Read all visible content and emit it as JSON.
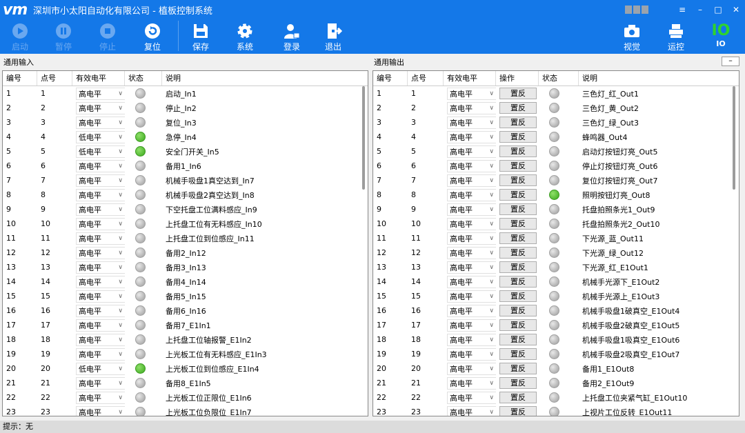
{
  "titlebar": {
    "logo": "vm",
    "title": "深圳市小太阳自动化有限公司 - 植板控制系统",
    "menu": "≡",
    "minimize": "–",
    "maximize": "□",
    "close": "✕"
  },
  "toolbar": {
    "start": "启动",
    "pause": "暂停",
    "stop": "停止",
    "reset": "复位",
    "save": "保存",
    "system": "系统",
    "login": "登录",
    "exit": "退出",
    "vision": "视觉",
    "motion": "运控",
    "io_big": "IO",
    "io_small": "IO"
  },
  "input_panel": {
    "title": "通用输入",
    "headers": [
      "编号",
      "点号",
      "有效电平",
      "状态",
      "说明"
    ],
    "rows": [
      {
        "no": "1",
        "pt": "1",
        "level": "高电平",
        "on": false,
        "desc": "启动_In1"
      },
      {
        "no": "2",
        "pt": "2",
        "level": "高电平",
        "on": false,
        "desc": "停止_In2"
      },
      {
        "no": "3",
        "pt": "3",
        "level": "高电平",
        "on": false,
        "desc": "复位_In3"
      },
      {
        "no": "4",
        "pt": "4",
        "level": "低电平",
        "on": true,
        "desc": "急停_In4"
      },
      {
        "no": "5",
        "pt": "5",
        "level": "低电平",
        "on": true,
        "desc": "安全门开关_In5"
      },
      {
        "no": "6",
        "pt": "6",
        "level": "高电平",
        "on": false,
        "desc": "备用1_In6"
      },
      {
        "no": "7",
        "pt": "7",
        "level": "高电平",
        "on": false,
        "desc": "机械手吸盘1真空达到_In7"
      },
      {
        "no": "8",
        "pt": "8",
        "level": "高电平",
        "on": false,
        "desc": "机械手吸盘2真空达到_In8"
      },
      {
        "no": "9",
        "pt": "9",
        "level": "高电平",
        "on": false,
        "desc": "下空托盘工位满料感应_In9"
      },
      {
        "no": "10",
        "pt": "10",
        "level": "高电平",
        "on": false,
        "desc": "上托盘工位有无料感应_In10"
      },
      {
        "no": "11",
        "pt": "11",
        "level": "高电平",
        "on": false,
        "desc": "上托盘工位到位感应_In11"
      },
      {
        "no": "12",
        "pt": "12",
        "level": "高电平",
        "on": false,
        "desc": "备用2_In12"
      },
      {
        "no": "13",
        "pt": "13",
        "level": "高电平",
        "on": false,
        "desc": "备用3_In13"
      },
      {
        "no": "14",
        "pt": "14",
        "level": "高电平",
        "on": false,
        "desc": "备用4_In14"
      },
      {
        "no": "15",
        "pt": "15",
        "level": "高电平",
        "on": false,
        "desc": "备用5_In15"
      },
      {
        "no": "16",
        "pt": "16",
        "level": "高电平",
        "on": false,
        "desc": "备用6_In16"
      },
      {
        "no": "17",
        "pt": "17",
        "level": "高电平",
        "on": false,
        "desc": "备用7_E1In1"
      },
      {
        "no": "18",
        "pt": "18",
        "level": "高电平",
        "on": false,
        "desc": "上托盘工位轴报警_E1In2"
      },
      {
        "no": "19",
        "pt": "19",
        "level": "高电平",
        "on": false,
        "desc": "上光板工位有无料感应_E1In3"
      },
      {
        "no": "20",
        "pt": "20",
        "level": "低电平",
        "on": true,
        "desc": "上光板工位到位感应_E1In4"
      },
      {
        "no": "21",
        "pt": "21",
        "level": "高电平",
        "on": false,
        "desc": "备用8_E1In5"
      },
      {
        "no": "22",
        "pt": "22",
        "level": "高电平",
        "on": false,
        "desc": "上光板工位正限位_E1In6"
      },
      {
        "no": "23",
        "pt": "23",
        "level": "高电平",
        "on": false,
        "desc": "上光板工位负限位_E1In7"
      }
    ]
  },
  "output_panel": {
    "title": "通用输出",
    "collapse": "–",
    "headers": [
      "编号",
      "点号",
      "有效电平",
      "操作",
      "状态",
      "说明"
    ],
    "flip_label": "置反",
    "rows": [
      {
        "no": "1",
        "pt": "1",
        "level": "高电平",
        "on": false,
        "desc": "三色灯_红_Out1"
      },
      {
        "no": "2",
        "pt": "2",
        "level": "高电平",
        "on": false,
        "desc": "三色灯_黄_Out2"
      },
      {
        "no": "3",
        "pt": "3",
        "level": "高电平",
        "on": false,
        "desc": "三色灯_绿_Out3"
      },
      {
        "no": "4",
        "pt": "4",
        "level": "高电平",
        "on": false,
        "desc": "蜂鸣器_Out4"
      },
      {
        "no": "5",
        "pt": "5",
        "level": "高电平",
        "on": false,
        "desc": "启动灯按钮灯亮_Out5"
      },
      {
        "no": "6",
        "pt": "6",
        "level": "高电平",
        "on": false,
        "desc": "停止灯按钮灯亮_Out6"
      },
      {
        "no": "7",
        "pt": "7",
        "level": "高电平",
        "on": false,
        "desc": "复位灯按钮灯亮_Out7"
      },
      {
        "no": "8",
        "pt": "8",
        "level": "高电平",
        "on": true,
        "desc": "照明按钮灯亮_Out8"
      },
      {
        "no": "9",
        "pt": "9",
        "level": "高电平",
        "on": false,
        "desc": "托盘拍照条光1_Out9"
      },
      {
        "no": "10",
        "pt": "10",
        "level": "高电平",
        "on": false,
        "desc": "托盘拍照条光2_Out10"
      },
      {
        "no": "11",
        "pt": "11",
        "level": "高电平",
        "on": false,
        "desc": "下光源_蓝_Out11"
      },
      {
        "no": "12",
        "pt": "12",
        "level": "高电平",
        "on": false,
        "desc": "下光源_绿_Out12"
      },
      {
        "no": "13",
        "pt": "13",
        "level": "高电平",
        "on": false,
        "desc": "下光源_红_E1Out1"
      },
      {
        "no": "14",
        "pt": "14",
        "level": "高电平",
        "on": false,
        "desc": "机械手光源下_E1Out2"
      },
      {
        "no": "15",
        "pt": "15",
        "level": "高电平",
        "on": false,
        "desc": "机械手光源上_E1Out3"
      },
      {
        "no": "16",
        "pt": "16",
        "level": "高电平",
        "on": false,
        "desc": "机械手吸盘1破真空_E1Out4"
      },
      {
        "no": "17",
        "pt": "17",
        "level": "高电平",
        "on": false,
        "desc": "机械手吸盘2破真空_E1Out5"
      },
      {
        "no": "18",
        "pt": "18",
        "level": "高电平",
        "on": false,
        "desc": "机械手吸盘1吸真空_E1Out6"
      },
      {
        "no": "19",
        "pt": "19",
        "level": "高电平",
        "on": false,
        "desc": "机械手吸盘2吸真空_E1Out7"
      },
      {
        "no": "20",
        "pt": "20",
        "level": "高电平",
        "on": false,
        "desc": "备用1_E1Out8"
      },
      {
        "no": "21",
        "pt": "21",
        "level": "高电平",
        "on": false,
        "desc": "备用2_E1Out9"
      },
      {
        "no": "22",
        "pt": "22",
        "level": "高电平",
        "on": false,
        "desc": "上托盘工位夹紧气缸_E1Out10"
      },
      {
        "no": "23",
        "pt": "23",
        "level": "高电平",
        "on": false,
        "desc": "上视片工位反转_E1Out11"
      }
    ]
  },
  "status": {
    "text": "提示：无"
  },
  "colors": {
    "accent": "#1478e8",
    "led_on": "#3aa81c",
    "led_off": "#a0a0a0",
    "io_green": "#2ed32e"
  }
}
